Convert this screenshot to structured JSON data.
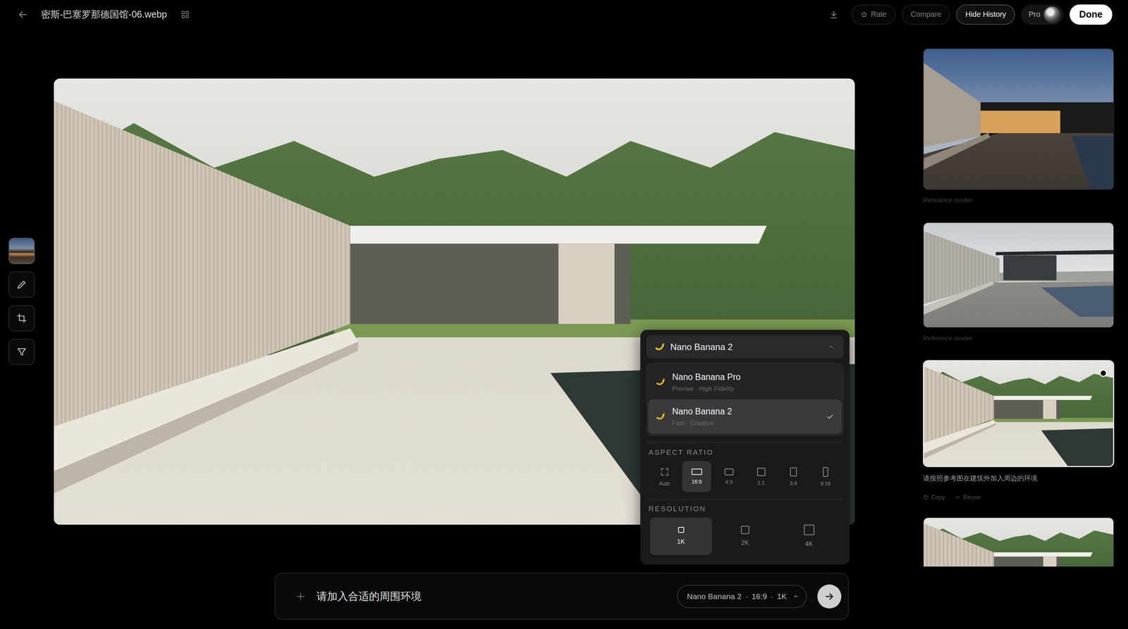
{
  "window": {
    "title": "密斯-巴塞罗那德国馆-06.webp"
  },
  "buttons": [
    {
      "label": "Rate",
      "kind": "rate"
    },
    {
      "label": "Compare",
      "kind": "plain"
    },
    {
      "label": "Hide History",
      "kind": "outlined"
    },
    {
      "label": "Pro",
      "kind": "account"
    },
    {
      "label": "Done",
      "kind": "primary"
    }
  ],
  "tools": [
    {
      "kind": "thumbnail"
    },
    {
      "kind": "pencil"
    },
    {
      "kind": "crop"
    },
    {
      "kind": "filter"
    }
  ],
  "model_menu": {
    "current": "Nano Banana 2",
    "expanded": true,
    "options": [
      {
        "name": "Nano Banana Pro",
        "description": "Precise · High Fidelity",
        "selected": false
      },
      {
        "name": "Nano Banana 2",
        "description": "Fast · Creative",
        "selected": true
      }
    ],
    "aspect_ratio": {
      "label": "ASPECT RATIO",
      "options": [
        {
          "label": "Auto",
          "kind": "auto",
          "selected": false
        },
        {
          "label": "16:9",
          "kind": "wide",
          "selected": true
        },
        {
          "label": "4:3",
          "kind": "landscape",
          "selected": false
        },
        {
          "label": "1:1",
          "kind": "square",
          "selected": false
        },
        {
          "label": "3:4",
          "kind": "portrait",
          "selected": false
        },
        {
          "label": "9:16",
          "kind": "tall",
          "selected": false
        }
      ]
    },
    "resolution": {
      "label": "RESOLUTION",
      "options": [
        {
          "label": "1K",
          "kind": "small",
          "selected": true
        },
        {
          "label": "2K",
          "kind": "medium",
          "selected": false
        },
        {
          "label": "4K",
          "kind": "large",
          "selected": false
        }
      ]
    }
  },
  "prompt": {
    "text": "请加入合适的周围环境",
    "chip": [
      "Nano Banana 2",
      "·",
      "16:9",
      "·",
      "1K"
    ]
  },
  "history": [
    {
      "kind": "dusk",
      "caption": "Reference render",
      "selected": false
    },
    {
      "kind": "overcast",
      "caption": "Reference render",
      "selected": false
    },
    {
      "kind": "garden",
      "caption": "请按照参考图在建筑外加入周边的环境",
      "selected": true,
      "actions": [
        "Copy",
        "Reuse"
      ]
    },
    {
      "kind": "garden",
      "selected": false
    }
  ]
}
